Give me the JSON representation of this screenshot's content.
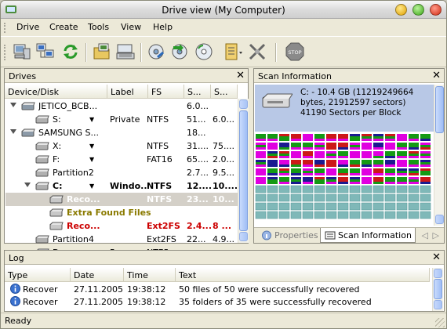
{
  "window": {
    "title": "Drive view (My Computer)"
  },
  "menu": [
    "Drive",
    "Create",
    "Tools",
    "View",
    "Help"
  ],
  "toolbar": {
    "buttons": [
      "computer-icon",
      "network-computers-icon",
      "refresh-icon",
      "open-image-icon",
      "keyboard-icon",
      "scan-icon",
      "restore-icon",
      "disk-image-icon",
      "file-options-icon",
      "disconnect-icon",
      "stop-icon"
    ],
    "stop_label": "STOP"
  },
  "drives": {
    "panel_title": "Drives",
    "columns": [
      "Device/Disk",
      "Label",
      "FS",
      "S...",
      "S..."
    ],
    "rows": [
      {
        "name": "JETICO_BCB...",
        "label": "",
        "fs": "",
        "s1": "6.0...",
        "s2": "",
        "indent": 0,
        "expander": true,
        "dropdown": false,
        "style": "normal"
      },
      {
        "name": "S:",
        "label": "Private",
        "fs": "NTFS",
        "s1": "51...",
        "s2": "6.0...",
        "indent": 1,
        "expander": false,
        "dropdown": true,
        "style": "normal"
      },
      {
        "name": "SAMSUNG S...",
        "label": "",
        "fs": "",
        "s1": "18...",
        "s2": "",
        "indent": 0,
        "expander": true,
        "dropdown": false,
        "style": "normal"
      },
      {
        "name": "X:",
        "label": "",
        "fs": "NTFS",
        "s1": "31....",
        "s2": "75....",
        "indent": 1,
        "expander": false,
        "dropdown": true,
        "style": "normal"
      },
      {
        "name": "F:",
        "label": "",
        "fs": "FAT16",
        "s1": "65....",
        "s2": "2.0...",
        "indent": 1,
        "expander": false,
        "dropdown": true,
        "style": "normal"
      },
      {
        "name": "Partition2",
        "label": "",
        "fs": "",
        "s1": "2.7...",
        "s2": "9.5...",
        "indent": 1,
        "expander": false,
        "dropdown": false,
        "style": "normal"
      },
      {
        "name": "C:",
        "label": "Windo...",
        "fs": "NTFS",
        "s1": "12....",
        "s2": "10....",
        "indent": 1,
        "expander": true,
        "dropdown": true,
        "style": "bold"
      },
      {
        "name": "Reco...",
        "label": "",
        "fs": "NTFS",
        "s1": "23...",
        "s2": "10...",
        "indent": 2,
        "expander": false,
        "dropdown": false,
        "style": "selected"
      },
      {
        "name": "Extra Found Files",
        "label": "",
        "fs": "",
        "s1": "",
        "s2": "",
        "indent": 2,
        "expander": false,
        "dropdown": false,
        "style": "olive"
      },
      {
        "name": "Reco...",
        "label": "",
        "fs": "Ext2FS",
        "s1": "2.4...",
        "s2": "8 ...",
        "indent": 2,
        "expander": false,
        "dropdown": false,
        "style": "red"
      },
      {
        "name": "Partition4",
        "label": "",
        "fs": "Ext2FS",
        "s1": "22...",
        "s2": "4.9...",
        "indent": 1,
        "expander": false,
        "dropdown": false,
        "style": "normal"
      },
      {
        "name": "D:",
        "label": "Progra...",
        "fs": "NTFS",
        "s1": "",
        "s2": "",
        "indent": 1,
        "expander": false,
        "dropdown": true,
        "style": "normal"
      }
    ]
  },
  "scan": {
    "panel_title": "Scan Information",
    "info_text": "C: - 10.4 GB (11219249664 bytes, 21912597 sectors)  41190 Sectors per Block",
    "tabs": [
      "Properties",
      "Scan Information"
    ],
    "colors": {
      "magenta": "#e000e0",
      "green": "#149a14",
      "navy": "#1a1a90",
      "red": "#cc1818",
      "teal": "#7fb8b8",
      "teal_line": "#5a9c9c"
    }
  },
  "log": {
    "panel_title": "Log",
    "columns": [
      "Type",
      "Date",
      "Time",
      "Text"
    ],
    "rows": [
      {
        "type": "Recover",
        "date": "27.11.2005",
        "time": "19:38:12",
        "text": "50 files of 50 were successfully recovered"
      },
      {
        "type": "Recover",
        "date": "27.11.2005",
        "time": "19:38:12",
        "text": "35 folders of 35 were successfully recovered"
      }
    ]
  },
  "status": {
    "text": "Ready"
  }
}
